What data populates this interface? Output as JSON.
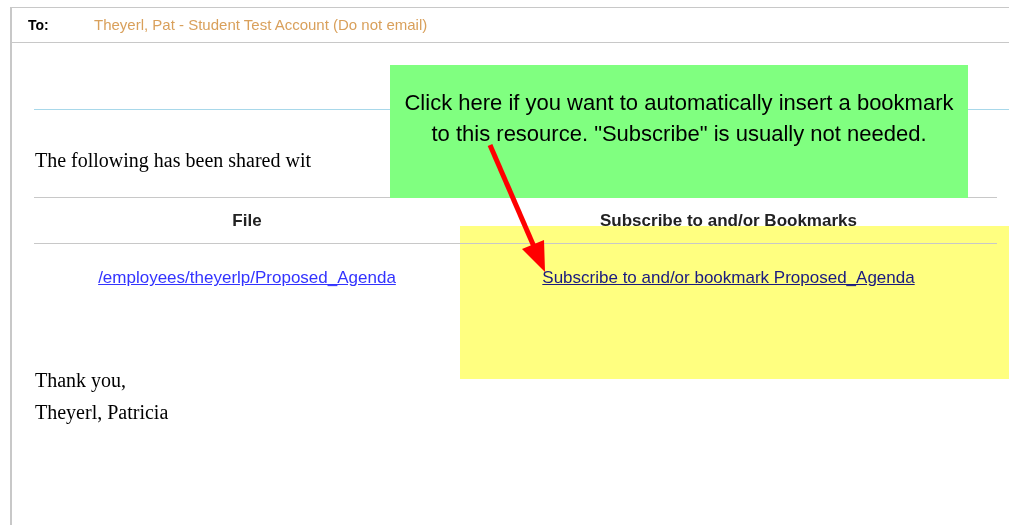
{
  "email": {
    "to_label": "To:",
    "recipient": "Theyerl, Pat - Student Test Account (Do not email)",
    "intro": "The following has been shared wit",
    "table": {
      "columns": [
        "File",
        "Subscribe to and/or Bookmarks"
      ],
      "rows": [
        {
          "file": "/employees/theyerlp/Proposed_Agenda",
          "subscribe": "Subscribe to and/or bookmark Proposed_Agenda"
        }
      ]
    },
    "closing": "Thank you,",
    "signature": "Theyerl, Patricia"
  },
  "annotation": {
    "callout": "Click here if you want to automatically insert a bookmark to this resource. \"Subscribe\" is usually not needed."
  }
}
